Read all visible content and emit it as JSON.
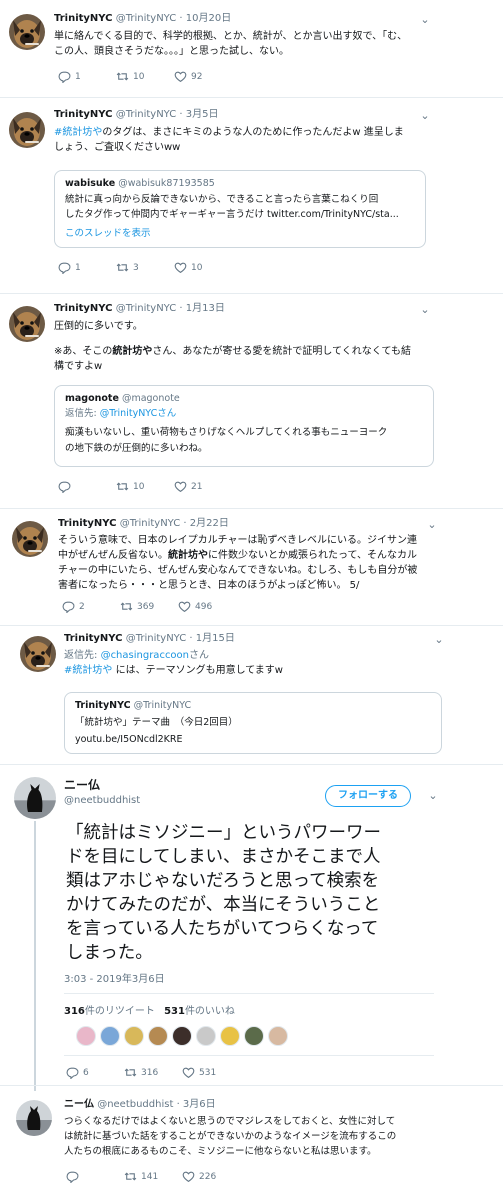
{
  "tweets": [
    {
      "name": "TrinityNYC",
      "handle": "@TrinityNYC",
      "date": "· 10月20日",
      "lines": [
        "単に絡んでくる目的で、科学的根拠、とか、統計が、とか言い出す奴で、「む、",
        "この人、頭良さそうだな。。。」と思った試し、ない。"
      ],
      "reply_count": "1",
      "retweet_count": "10",
      "like_count": "92"
    },
    {
      "name": "TrinityNYC",
      "handle": "@TrinityNYC",
      "date": "· 3月5日",
      "hashtag": "#統計坊や",
      "line1_rest": "のタグは、まさにキミのような人のために作ったんだよw  進呈しま",
      "line2": "しょう、ご査収くださいww",
      "quote": {
        "name": "wabisuke",
        "handle": "@wabisuk87193585",
        "line1": "統計に真っ向から反論できないから、できること言ったら言葉こねくり回",
        "line2": "したタグ作って仲間内でギャーギャー言うだけ twitter.com/TrinityNYC/sta...",
        "thread_link": "このスレッドを表示"
      },
      "reply_count": "1",
      "retweet_count": "3",
      "like_count": "10"
    },
    {
      "name": "TrinityNYC",
      "handle": "@TrinityNYC",
      "date": "· 1月13日",
      "line1": "圧倒的に多いです。",
      "line2_pre": "※あ、そこの",
      "line2_bold": "統計坊や",
      "line2_post": "さん、あなたが寄せる愛を統計で証明してくれなくても結",
      "line3": "構ですよw",
      "quote": {
        "name": "magonote",
        "handle": "@magonote",
        "reply_to_label": "返信先:",
        "reply_to_handle": "@TrinityNYCさん",
        "line1": "痴漢もいないし、重い荷物もさりげなくヘルプしてくれる事もニューヨーク",
        "line2": "の地下鉄のが圧倒的に多いわね。"
      },
      "reply_count": "",
      "retweet_count": "10",
      "like_count": "21"
    },
    {
      "name": "TrinityNYC",
      "handle": "@TrinityNYC",
      "date": "· 2月22日",
      "line1": "そういう意味で、日本のレイプカルチャーは恥ずべきレベルにいる。ジイサン連",
      "line2": "中がぜんぜん反省ない。",
      "line3_bold": "統計坊や",
      "line3_post": "に件数少ないとか威張られたって、そんなカル",
      "line3_pre": "",
      "line4": "チャーの中にいたら、ぜんぜん安心なんてできないね。むしろ、もしも自分が被",
      "line5": "害者になったら・・・と思うとき、日本のほうがよっぽど怖い。 5/",
      "reply_count": "2",
      "retweet_count": "369",
      "like_count": "496"
    },
    {
      "name": "TrinityNYC",
      "handle": "@TrinityNYC",
      "date": "· 1月15日",
      "reply_to_label": "返信先:",
      "reply_to_handle": "@chasingraccoon",
      "reply_to_suffix": "さん",
      "hashtag": "#統計坊や",
      "line_rest": " には、テーマソングも用意してますw",
      "quote": {
        "name": "TrinityNYC",
        "handle": "@TrinityNYC",
        "line1": "「統計坊や」テーマ曲　（今日2回目）",
        "line2": "youtu.be/I5ONcdl2KRE"
      }
    }
  ],
  "main_tweet": {
    "name": "ニー仏",
    "handle": "@neetbuddhist",
    "follow_label": "フォローする",
    "lines": [
      "「統計はミソジニー」というパワーワー",
      "ドを目にしてしまい、まさかそこまで人",
      "類はアホじゃないだろうと思って検索を",
      "かけてみたのだが、本当にそういうこと",
      "を言っている人たちがいてつらくなって",
      "しまった。"
    ],
    "timestamp": "3:03 - 2019年3月6日",
    "retweet_count": "316",
    "retweet_label": "件のリツイート",
    "like_count": "531",
    "like_label": "件のいいね",
    "reply_count": "6",
    "action_retweet": "316",
    "action_like": "531"
  },
  "last_tweet": {
    "name": "ニー仏",
    "handle": "@neetbuddhist",
    "date": "· 3月6日",
    "lines": [
      "つらくなるだけではよくないと思うのでマジレスをしておくと、女性に対して",
      "は統計に基づいた話をすることができないかのようなイメージを流布するこの",
      "人たちの根底にあるものこそ、ミソジニーに他ならないと私は思います。"
    ],
    "reply_count": "",
    "retweet_count": "141",
    "like_count": "226"
  },
  "icons": {
    "reply": "reply-icon",
    "retweet": "retweet-icon",
    "like": "heart-icon",
    "more": "chevron-down-icon"
  },
  "colors": {
    "link": "#1b95e0",
    "meta": "#657786",
    "follow": "#1da1f2",
    "divider": "#e6ecf0"
  }
}
